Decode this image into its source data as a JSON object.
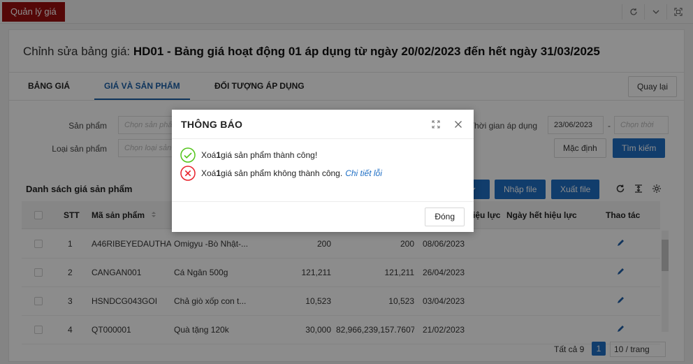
{
  "app": {
    "tab_label": "Quản lý giá",
    "top_icons": [
      "refresh-icon",
      "chevron-down-icon",
      "fullscreen-icon"
    ]
  },
  "page": {
    "title_prefix": "Chỉnh sửa bảng giá: ",
    "title_main": "HD01 - Bảng giá hoạt động 01 áp dụng từ ngày 20/02/2023 đến hết ngày 31/03/2025",
    "back_label": "Quay lại"
  },
  "tabs": [
    {
      "label": "BẢNG GIÁ",
      "active": false
    },
    {
      "label": "GIÁ VÀ SẢN PHẨM",
      "active": true
    },
    {
      "label": "ĐỐI TƯỢNG ÁP DỤNG",
      "active": false
    }
  ],
  "filters": {
    "product_label": "Sản phẩm",
    "product_placeholder": "Chọn sản phẩm",
    "product_type_label": "Loại sản phẩm",
    "product_type_placeholder": "Chọn loại sản phẩm",
    "apply_time_label": "Thời gian áp dụng",
    "date_from": "23/06/2023",
    "date_sep": "-",
    "date_to_placeholder": "Chọn thời",
    "default_btn": "Mặc định",
    "search_btn": "Tìm kiếm"
  },
  "list": {
    "title": "Danh sách giá sản phẩm",
    "import_btn": "Nhập file",
    "export_btn": "Xuất file",
    "columns": {
      "stt": "STT",
      "code": "Mã sản phẩm",
      "effective": "Ngày hiệu lực",
      "expiry": "Ngày hết hiệu lực",
      "action": "Thao tác"
    },
    "rows": [
      {
        "stt": "1",
        "code": "A46RIBEYEDAUTHAN",
        "name": "Omigyu -Bò Nhật-...",
        "price1": "200",
        "price2": "200",
        "date": "08/06/2023"
      },
      {
        "stt": "2",
        "code": "CANGAN001",
        "name": "Cá Ngân 500g",
        "price1": "121,211",
        "price2": "121,211",
        "date": "26/04/2023"
      },
      {
        "stt": "3",
        "code": "HSNDCG043GOI",
        "name": "Chả giò xốp con t...",
        "price1": "10,523",
        "price2": "10,523",
        "date": "03/04/2023"
      },
      {
        "stt": "4",
        "code": "QT000001",
        "name": "Quà tặng 120k",
        "price1": "30,000",
        "price2": "82,966,239,157.7607",
        "date": "21/02/2023"
      }
    ],
    "pager": {
      "total": "Tất cả 9",
      "page": "1",
      "page_size": "10 / trang"
    }
  },
  "modal": {
    "title": "THÔNG BÁO",
    "success": {
      "pre": "Xoá ",
      "count": "1",
      "post": " giá sản phẩm thành công!"
    },
    "fail": {
      "pre": "Xoá ",
      "count": "1",
      "post": " giá sản phẩm không thành công.",
      "link": "Chi tiết lỗi"
    },
    "close_label": "Đóng"
  },
  "colors": {
    "brand_red": "#9b1010",
    "primary_blue": "#1f6fc5",
    "success_green": "#52c41a",
    "error_red": "#e8222b"
  }
}
